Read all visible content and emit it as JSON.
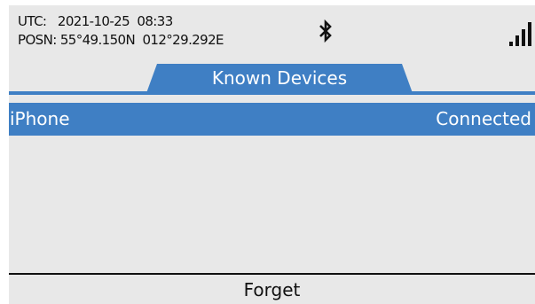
{
  "status_bar": {
    "utc_text": "UTC:   2021-10-25  08:33",
    "position_text": "POSN: 55°49.150N  012°29.292E",
    "bluetooth_icon": "bluetooth-icon",
    "signal_icon": "signal-strength-icon"
  },
  "tab": {
    "title": "Known Devices"
  },
  "devices": [
    {
      "name": "iPhone",
      "status": "Connected"
    }
  ],
  "softkey": {
    "label": "Forget"
  },
  "colors": {
    "accent": "#3f7fc4",
    "screen_background": "#e8e8e8",
    "text": "#111111"
  }
}
